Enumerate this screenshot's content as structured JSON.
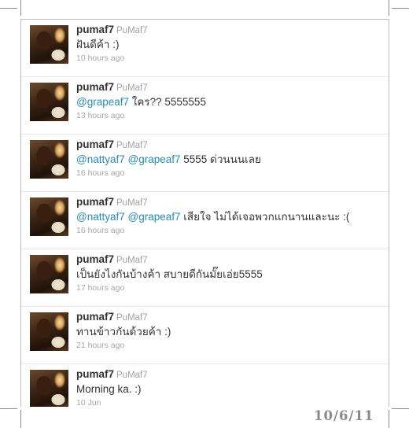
{
  "tweets": [
    {
      "name": "pumaf7",
      "screen_name": "PuMaf7",
      "segments": [
        {
          "type": "text",
          "value": "ฝันดีค้า :)"
        }
      ],
      "time": "10 hours ago"
    },
    {
      "name": "pumaf7",
      "screen_name": "PuMaf7",
      "segments": [
        {
          "type": "mention",
          "value": "@grapeaf7"
        },
        {
          "type": "text",
          "value": " ใคร?? 5555555"
        }
      ],
      "time": "13 hours ago"
    },
    {
      "name": "pumaf7",
      "screen_name": "PuMaf7",
      "segments": [
        {
          "type": "mention",
          "value": "@nattyaf7"
        },
        {
          "type": "text",
          "value": " "
        },
        {
          "type": "mention",
          "value": "@grapeaf7"
        },
        {
          "type": "text",
          "value": " 5555 ด่วนนนเลย"
        }
      ],
      "time": "16 hours ago"
    },
    {
      "name": "pumaf7",
      "screen_name": "PuMaf7",
      "segments": [
        {
          "type": "mention",
          "value": "@nattyaf7"
        },
        {
          "type": "text",
          "value": " "
        },
        {
          "type": "mention",
          "value": "@grapeaf7"
        },
        {
          "type": "text",
          "value": " เสียใจ ไม่ได้เจอพวกแกนานและนะ :("
        }
      ],
      "time": "16 hours ago"
    },
    {
      "name": "pumaf7",
      "screen_name": "PuMaf7",
      "segments": [
        {
          "type": "text",
          "value": "เป็นยังไงกันบ้างค้า สบายดีกันมั๊ยเอ่ย5555"
        }
      ],
      "time": "17 hours ago"
    },
    {
      "name": "pumaf7",
      "screen_name": "PuMaf7",
      "segments": [
        {
          "type": "text",
          "value": "ทานข้าวกันด้วยค้า :)"
        }
      ],
      "time": "21 hours ago"
    },
    {
      "name": "pumaf7",
      "screen_name": "PuMaf7",
      "segments": [
        {
          "type": "text",
          "value": "Morning ka. :)"
        }
      ],
      "time": "10 Jun"
    }
  ],
  "date_stamp": "10/6/11",
  "colors": {
    "mention": "#2a8bb5",
    "text": "#333333",
    "meta": "#a7a7a7"
  }
}
